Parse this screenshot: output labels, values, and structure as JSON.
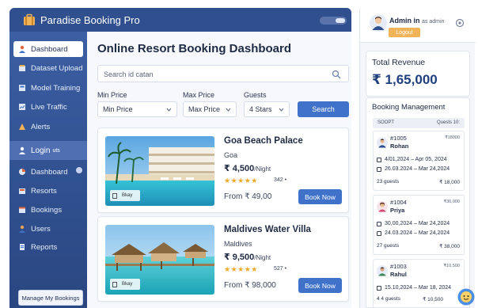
{
  "app": {
    "title": "Paradise Booking Pro",
    "brand_color": "#2f4f8e",
    "accent_color": "#3f72c8"
  },
  "sidebar": {
    "items": [
      {
        "label": "Dashboard",
        "icon": "user-icon"
      },
      {
        "label": "Dataset Upload",
        "icon": "upload-icon"
      },
      {
        "label": "Model Training",
        "icon": "model-icon"
      },
      {
        "label": "Live Traffic",
        "icon": "traffic-icon"
      },
      {
        "label": "Alerts",
        "icon": "alert-icon"
      }
    ],
    "section_label": "Login",
    "section_suffix": "uts",
    "sub_items": [
      {
        "label": "Dashboard",
        "icon": "dashboard-icon"
      },
      {
        "label": "Resorts",
        "icon": "resort-icon"
      },
      {
        "label": "Bookings",
        "icon": "booking-icon"
      },
      {
        "label": "Users",
        "icon": "users-icon"
      },
      {
        "label": "Reports",
        "icon": "report-icon"
      }
    ],
    "manage_button": "Manage My Bookings"
  },
  "main": {
    "title": "Online Resort Booking Dashboard",
    "search_placeholder": "Search id catan",
    "filters": {
      "min_price_label": "Min Price",
      "min_price_value": "Min Price",
      "max_price_label": "Max Price",
      "max_price_value": "Max Price",
      "guests_label": "Guests",
      "guests_value": "4 Stars",
      "search_button": "Search"
    },
    "resorts": [
      {
        "name": "Goa Beach Palace",
        "location": "Goa",
        "price": "₹ 4,500",
        "per": "/Night",
        "stars": "★★★★★",
        "reviews": "342 •",
        "from": "From ₹ 49,00",
        "button": "Book Now",
        "badge": "Bkay",
        "image": "beach-resort-pool"
      },
      {
        "name": "Maldives Water Villa",
        "location": "Maldives",
        "price": "₹ 9,500",
        "per": "/Night",
        "stars": "★★★★★",
        "reviews": "527 •",
        "from": "From ₹ 98,000",
        "button": "Book Now",
        "badge": "Bkay",
        "image": "water-villa"
      }
    ]
  },
  "right_panel": {
    "admin": {
      "name": "Admin in",
      "role": "as admin",
      "logout": "Logout"
    },
    "revenue": {
      "label": "Total Revenue",
      "value": "₹ 1,65,000"
    },
    "booking_management": {
      "title": "Booking Management",
      "header_left": "SOOPT",
      "header_right": "Quests 10:",
      "bookings": [
        {
          "id": "#1005",
          "name": "Rohan",
          "amount": "₹18000",
          "date1": "4/01,2024 – Apr 05, 2024",
          "date2": "26.03.2024 – Mar 24,2024",
          "guests": "23 guests",
          "total": "₹ 18,000"
        },
        {
          "id": "#1004",
          "name": "Priya",
          "amount": "₹36,000",
          "date1": "30,00,2024 – Mar 24,2024",
          "date2": "24.03.2024 – Mar 24,2024",
          "guests": "27 guests",
          "total": "₹ 38,000"
        },
        {
          "id": "#1003",
          "name": "Rahul",
          "amount": "₹10,500",
          "date1": "15.10,2024 – Mar 18, 2024",
          "date2": "",
          "guests": "4  4 guests",
          "total": "₹ 10,500"
        }
      ]
    }
  }
}
